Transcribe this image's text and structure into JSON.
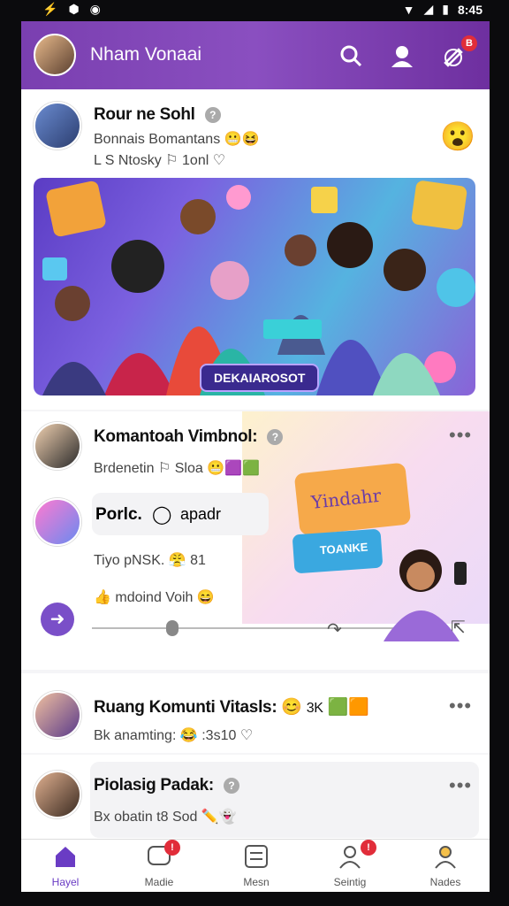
{
  "status_bar": {
    "time": "8:45"
  },
  "header": {
    "title": "Nham Vonaai"
  },
  "posts": [
    {
      "name": "Rour ne Sohl",
      "line1": "Bonnais Bomantans",
      "line2": "L S Ntosky",
      "line2b": "1onl",
      "banner": {
        "cta_label": "DEKAIAROSOT"
      }
    },
    {
      "name": "Komantoah Vimbnol:",
      "line1": "Brdenetin",
      "line1b": "Sloa",
      "reply_name": "Porlc.",
      "reply_text": "apadr",
      "line3": "Tiyo pNSK.",
      "line3b": "81",
      "line4": "mdoind Voih",
      "overlay_card": "Yindahr",
      "overlay_card2": "TOANKE"
    },
    {
      "name": "Ruang Komunti Vitasls:",
      "name_tail": "3K",
      "line1": "Bk anamting:",
      "line1b": ":3s10"
    },
    {
      "name": "Piolasig Padak:",
      "line1": "Bx obatin",
      "line1b": "t8",
      "line1c": "Sod"
    }
  ],
  "nav": [
    {
      "label": "Hayel",
      "icon": "home-icon"
    },
    {
      "label": "Madie",
      "icon": "chat-icon"
    },
    {
      "label": "Mesn",
      "icon": "grid-icon"
    },
    {
      "label": "Seintig",
      "icon": "profile-icon"
    },
    {
      "label": "Nades",
      "icon": "user-icon"
    }
  ],
  "colors": {
    "accent": "#7a3fb0",
    "badge": "#e12d3a"
  }
}
